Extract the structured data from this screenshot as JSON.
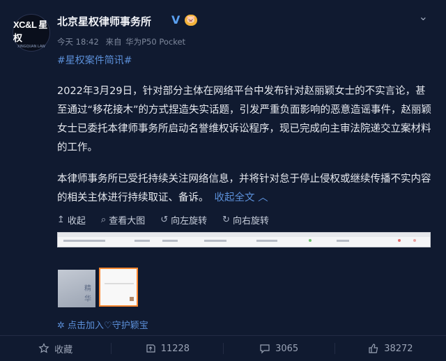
{
  "post": {
    "author": "北京星权律师事务所",
    "verified_badge": "V",
    "vip_badge": "🐷",
    "avatar_text": "XC&L 星权",
    "avatar_subtext": "XINGQUAN LAW",
    "time": "今天 18:42",
    "source_prefix": "来自",
    "source": "华为P50 Pocket",
    "topic": "#星权案件简讯#",
    "paragraph1": "2022年3月29日，针对部分主体在网络平台中发布针对赵丽颖女士的不实言论，甚至通过“移花接木”的方式捏造失实话题，引发严重负面影响的恶意造谣事件，赵丽颖女士已委托本律师事务所启动名誉维权诉讼程序，现已完成向主审法院递交立案材料的工作。",
    "paragraph2": "本律师事务所已受托持续关注网络信息，并将针对怠于停止侵权或继续传播不实内容的相关主体进行持续取证、备诉。",
    "collapse_label": "收起全文",
    "guard_text": "点击加入♡守护颖宝"
  },
  "image_toolbar": {
    "collapse": "收起",
    "view_large": "查看大图",
    "rotate_left": "向左旋转",
    "rotate_right": "向右旋转"
  },
  "thumb_text": "精华",
  "actions": {
    "favorite": "收藏",
    "repost_count": "11228",
    "comment_count": "3065",
    "like_count": "38272"
  },
  "colors": {
    "background": "#101a30",
    "link": "#5b8fd8",
    "selected_thumb_border": "#ff8a33"
  }
}
